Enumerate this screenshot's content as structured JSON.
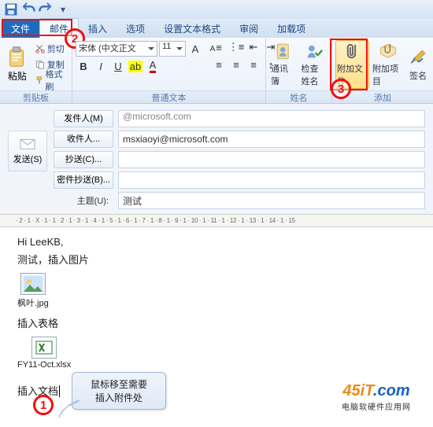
{
  "tabs": {
    "file": "文件",
    "mail": "邮件",
    "insert": "插入",
    "options": "选项",
    "format": "设置文本格式",
    "review": "审阅",
    "addins": "加载项"
  },
  "clipboard": {
    "paste": "粘贴",
    "cut": "剪切",
    "copy": "复制",
    "fmt": "格式刷",
    "group": "剪贴板"
  },
  "font": {
    "name": "宋体 (中文正文",
    "size": "11",
    "group": "普通文本"
  },
  "names": {
    "book": "通讯簿",
    "check": "检查姓名",
    "group": "姓名"
  },
  "add": {
    "attach": "附加文件",
    "item": "附加项目",
    "sig": "签名",
    "group": "添加"
  },
  "annot": {
    "n1": "1",
    "n2": "2",
    "n3": "3"
  },
  "compose": {
    "send": "发送(S)",
    "from": "发件人(M)",
    "from_val": "@microsoft.com",
    "to": "收件人...",
    "to_val": "msxiaoyi@microsoft.com",
    "cc": "抄送(C)...",
    "cc_val": "",
    "bcc": "密件抄送(B)...",
    "bcc_val": "",
    "subj": "主题(U):",
    "subj_val": "测试"
  },
  "ruler": "· 2 · 1 · X · 1 · 1 · 2 · 1 · 3 · 1 · 4 · 1 · 5 · 1 · 6 · 1 · 7 · 1 · 8 · 1 · 9 · 1 · 10 · 1 · 11 · 1 · 12 · 1 · 13 · 1 · 14 · 1 · 15",
  "body": {
    "l1": "Hi LeeKB,",
    "l2": "测试，插入图片",
    "img": "枫叶.jpg",
    "l3": "插入表格",
    "xls": "FY11-Oct.xlsx",
    "l4": "插入文档"
  },
  "callout": {
    "a": "鼠标移至需要",
    "b": "插入附件处"
  },
  "logo": {
    "t1": "45iT",
    "t2": ".com",
    "sub": "电脑软硬件应用网"
  }
}
